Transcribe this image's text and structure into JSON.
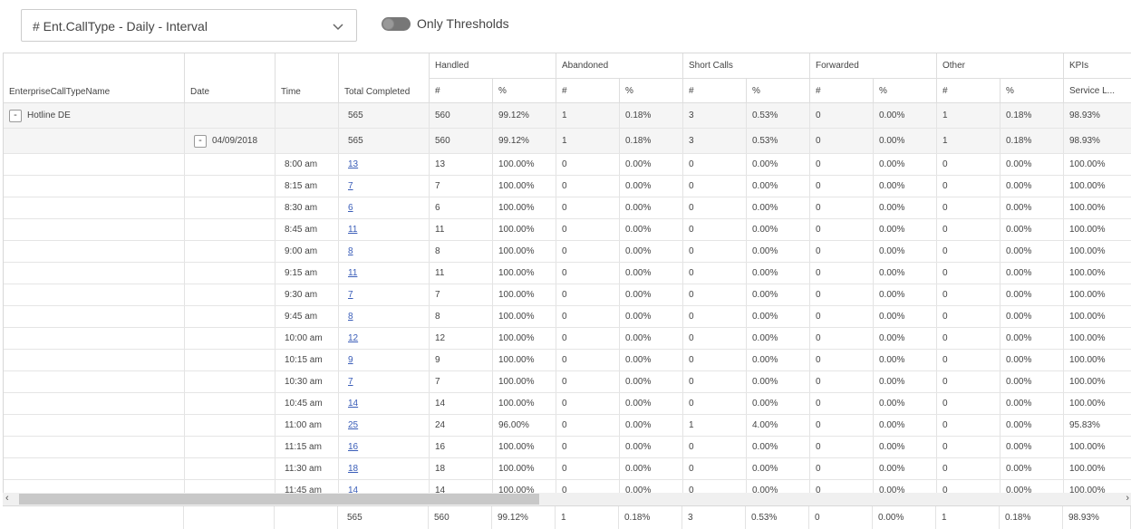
{
  "toolbar": {
    "report_select": "# Ent.CallType - Daily - Interval",
    "only_thresholds_label": "Only Thresholds"
  },
  "header": {
    "col_name": "EnterpriseCallTypeName",
    "col_date": "Date",
    "col_time": "Time",
    "col_total": "Total Completed",
    "groups": [
      "Handled",
      "Abandoned",
      "Short Calls",
      "Forwarded",
      "Other",
      "KPIs"
    ],
    "sub_count": "#",
    "sub_pct": "%",
    "kpi_sub": "Service L..."
  },
  "group_row": {
    "expander": "-",
    "name": "Hotline DE",
    "total": "565",
    "values": [
      "560",
      "99.12%",
      "1",
      "0.18%",
      "3",
      "0.53%",
      "0",
      "0.00%",
      "1",
      "0.18%",
      "98.93%"
    ]
  },
  "date_row": {
    "expander": "-",
    "date": "04/09/2018",
    "total": "565",
    "values": [
      "560",
      "99.12%",
      "1",
      "0.18%",
      "3",
      "0.53%",
      "0",
      "0.00%",
      "1",
      "0.18%",
      "98.93%"
    ]
  },
  "interval_rows": [
    {
      "time": "8:00 am",
      "total": "13",
      "values": [
        "13",
        "100.00%",
        "0",
        "0.00%",
        "0",
        "0.00%",
        "0",
        "0.00%",
        "0",
        "0.00%",
        "100.00%"
      ]
    },
    {
      "time": "8:15 am",
      "total": "7",
      "values": [
        "7",
        "100.00%",
        "0",
        "0.00%",
        "0",
        "0.00%",
        "0",
        "0.00%",
        "0",
        "0.00%",
        "100.00%"
      ]
    },
    {
      "time": "8:30 am",
      "total": "6",
      "values": [
        "6",
        "100.00%",
        "0",
        "0.00%",
        "0",
        "0.00%",
        "0",
        "0.00%",
        "0",
        "0.00%",
        "100.00%"
      ]
    },
    {
      "time": "8:45 am",
      "total": "11",
      "values": [
        "11",
        "100.00%",
        "0",
        "0.00%",
        "0",
        "0.00%",
        "0",
        "0.00%",
        "0",
        "0.00%",
        "100.00%"
      ]
    },
    {
      "time": "9:00 am",
      "total": "8",
      "values": [
        "8",
        "100.00%",
        "0",
        "0.00%",
        "0",
        "0.00%",
        "0",
        "0.00%",
        "0",
        "0.00%",
        "100.00%"
      ]
    },
    {
      "time": "9:15 am",
      "total": "11",
      "values": [
        "11",
        "100.00%",
        "0",
        "0.00%",
        "0",
        "0.00%",
        "0",
        "0.00%",
        "0",
        "0.00%",
        "100.00%"
      ]
    },
    {
      "time": "9:30 am",
      "total": "7",
      "values": [
        "7",
        "100.00%",
        "0",
        "0.00%",
        "0",
        "0.00%",
        "0",
        "0.00%",
        "0",
        "0.00%",
        "100.00%"
      ]
    },
    {
      "time": "9:45 am",
      "total": "8",
      "values": [
        "8",
        "100.00%",
        "0",
        "0.00%",
        "0",
        "0.00%",
        "0",
        "0.00%",
        "0",
        "0.00%",
        "100.00%"
      ]
    },
    {
      "time": "10:00 am",
      "total": "12",
      "values": [
        "12",
        "100.00%",
        "0",
        "0.00%",
        "0",
        "0.00%",
        "0",
        "0.00%",
        "0",
        "0.00%",
        "100.00%"
      ]
    },
    {
      "time": "10:15 am",
      "total": "9",
      "values": [
        "9",
        "100.00%",
        "0",
        "0.00%",
        "0",
        "0.00%",
        "0",
        "0.00%",
        "0",
        "0.00%",
        "100.00%"
      ]
    },
    {
      "time": "10:30 am",
      "total": "7",
      "values": [
        "7",
        "100.00%",
        "0",
        "0.00%",
        "0",
        "0.00%",
        "0",
        "0.00%",
        "0",
        "0.00%",
        "100.00%"
      ]
    },
    {
      "time": "10:45 am",
      "total": "14",
      "values": [
        "14",
        "100.00%",
        "0",
        "0.00%",
        "0",
        "0.00%",
        "0",
        "0.00%",
        "0",
        "0.00%",
        "100.00%"
      ]
    },
    {
      "time": "11:00 am",
      "total": "25",
      "values": [
        "24",
        "96.00%",
        "0",
        "0.00%",
        "1",
        "4.00%",
        "0",
        "0.00%",
        "0",
        "0.00%",
        "95.83%"
      ]
    },
    {
      "time": "11:15 am",
      "total": "16",
      "values": [
        "16",
        "100.00%",
        "0",
        "0.00%",
        "0",
        "0.00%",
        "0",
        "0.00%",
        "0",
        "0.00%",
        "100.00%"
      ]
    },
    {
      "time": "11:30 am",
      "total": "18",
      "values": [
        "18",
        "100.00%",
        "0",
        "0.00%",
        "0",
        "0.00%",
        "0",
        "0.00%",
        "0",
        "0.00%",
        "100.00%"
      ]
    },
    {
      "time": "11:45 am",
      "total": "14",
      "values": [
        "14",
        "100.00%",
        "0",
        "0.00%",
        "0",
        "0.00%",
        "0",
        "0.00%",
        "0",
        "0.00%",
        "100.00%"
      ]
    }
  ],
  "footer": {
    "total": "565",
    "values": [
      "560",
      "99.12%",
      "1",
      "0.18%",
      "3",
      "0.53%",
      "0",
      "0.00%",
      "1",
      "0.18%",
      "98.93%"
    ]
  },
  "scrollbar": {
    "left_arrow": "‹",
    "right_arrow": "›"
  },
  "colors": {
    "link": "#3a5db8",
    "summary_bg": "#f5f5f5",
    "toggle_off": "#777777"
  }
}
